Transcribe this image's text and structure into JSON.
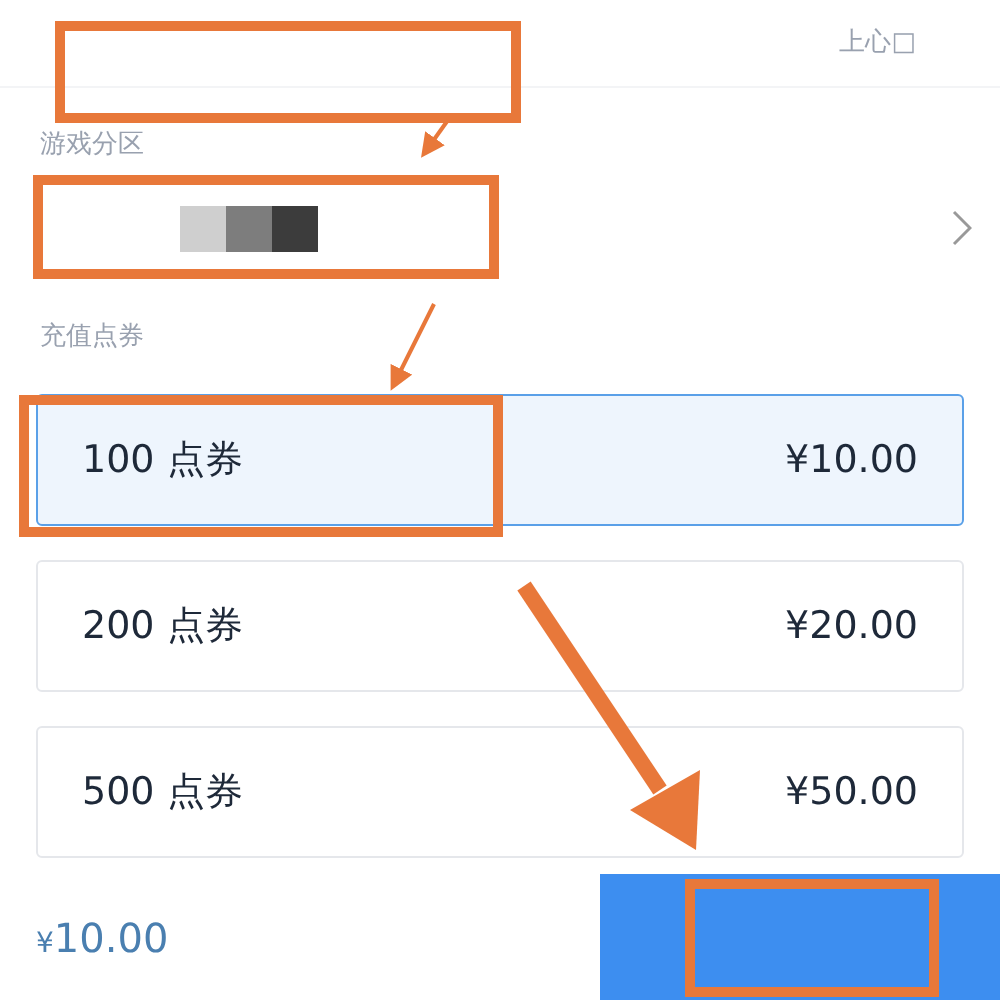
{
  "header": {
    "right_text": "上心□"
  },
  "server_section": {
    "label": "游戏分区"
  },
  "amount_section": {
    "label": "充值点券"
  },
  "options": [
    {
      "label": "100 点券",
      "price": "¥10.00",
      "selected": true
    },
    {
      "label": "200 点券",
      "price": "¥20.00",
      "selected": false
    },
    {
      "label": "500 点券",
      "price": "¥50.00",
      "selected": false
    }
  ],
  "footer": {
    "currency": "¥",
    "total": "10.00"
  }
}
